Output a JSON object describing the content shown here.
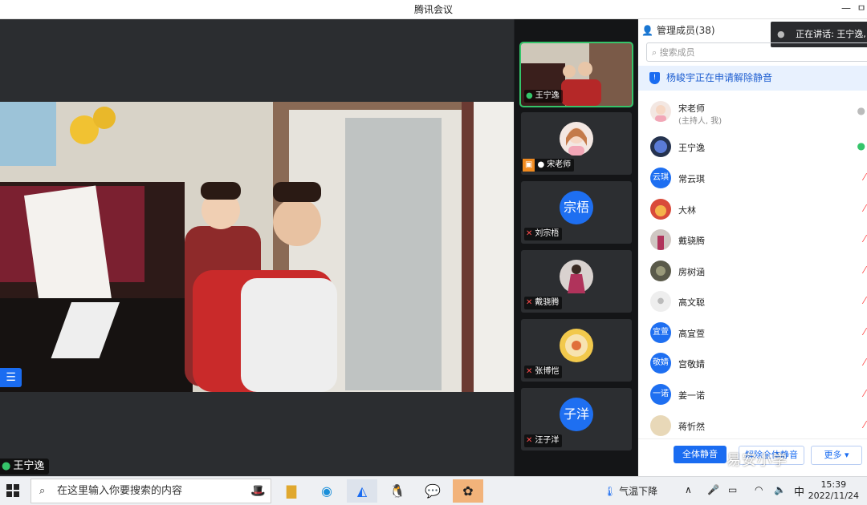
{
  "window": {
    "title": "腾讯会议",
    "minimize_icon": "—",
    "restore_icon": "ㅁ"
  },
  "main": {
    "speaker_name": "王宁逸",
    "list_icon": "☰"
  },
  "thumbs": [
    {
      "name": "王宁逸",
      "mic": "on",
      "type": "video"
    },
    {
      "name": "宋老师",
      "mic": "on",
      "type": "avatar-photo"
    },
    {
      "name": "刘宗梧",
      "mic": "off",
      "type": "initials",
      "initials": "宗梧"
    },
    {
      "name": "戴骁腾",
      "mic": "off",
      "type": "avatar-photo"
    },
    {
      "name": "张博恺",
      "mic": "off",
      "type": "avatar-photo"
    },
    {
      "name": "汪子洋",
      "mic": "off",
      "type": "initials",
      "initials": "子洋"
    }
  ],
  "panel": {
    "header": "管理成员(38)",
    "speaking_tip": "正在讲话: 王宁逸,",
    "search_placeholder": "搜索成员",
    "notice": "杨峻宇正在申请解除静音",
    "members": [
      {
        "name": "宋老师",
        "sub": "(主持人, 我)",
        "avatar": "",
        "mic": "gray"
      },
      {
        "name": "王宁逸",
        "sub": "",
        "avatar": "",
        "mic": "on"
      },
      {
        "name": "常云琪",
        "sub": "",
        "avatar": "云琪",
        "mic": "off"
      },
      {
        "name": "大林",
        "sub": "",
        "avatar": "",
        "mic": "off"
      },
      {
        "name": "戴骁腾",
        "sub": "",
        "avatar": "",
        "mic": "off"
      },
      {
        "name": "房树涵",
        "sub": "",
        "avatar": "",
        "mic": "off"
      },
      {
        "name": "高文聪",
        "sub": "",
        "avatar": "",
        "mic": "off"
      },
      {
        "name": "高宜萱",
        "sub": "",
        "avatar": "宜萱",
        "mic": "off"
      },
      {
        "name": "宫敬婧",
        "sub": "",
        "avatar": "敬婧",
        "mic": "off"
      },
      {
        "name": "姜一诺",
        "sub": "",
        "avatar": "一诺",
        "mic": "off"
      },
      {
        "name": "蒋忻然",
        "sub": "",
        "avatar": "",
        "mic": "off"
      }
    ],
    "footer": {
      "mute_all": "全体静音",
      "unmute_all": "解除全体静音",
      "more": "更多 ▾"
    }
  },
  "taskbar": {
    "search_placeholder": "在这里输入你要搜索的内容",
    "weather": "气温下降",
    "ime": "中",
    "time": "15:39",
    "date": "2022/11/24"
  },
  "watermark": "易安小学",
  "colors": {
    "accent": "#1a6cf1",
    "mic_on": "#35c46a",
    "mic_off": "#ff4b4b"
  }
}
